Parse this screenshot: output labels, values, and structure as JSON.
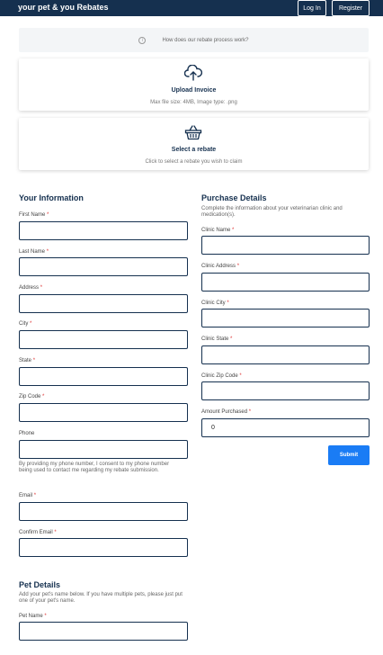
{
  "header": {
    "brand": "your pet & you Rebates",
    "login_label": "Log In",
    "register_label": "Register"
  },
  "info_bar": {
    "icon": "info-icon",
    "text": "How does our rebate process work?"
  },
  "upload_card": {
    "icon": "cloud-upload-icon",
    "title": "Upload Invoice",
    "subtitle": "Max file size: 4MB, Image type: .png"
  },
  "rebate_card": {
    "icon": "basket-icon",
    "title": "Select a rebate",
    "subtitle": "Click to select a rebate you wish to claim"
  },
  "your_info": {
    "title": "Your Information",
    "fields": [
      {
        "label": "First Name",
        "required": "*",
        "value": ""
      },
      {
        "label": "Last Name",
        "required": "*",
        "value": ""
      },
      {
        "label": "Address",
        "required": "*",
        "value": ""
      },
      {
        "label": "City",
        "required": "*",
        "value": ""
      },
      {
        "label": "State",
        "required": "*",
        "value": ""
      },
      {
        "label": "Zip Code",
        "required": "*",
        "value": ""
      },
      {
        "label": "Phone",
        "required": "",
        "value": ""
      },
      {
        "label": "Email",
        "required": "*",
        "value": ""
      },
      {
        "label": "Confirm Email",
        "required": "*",
        "value": ""
      }
    ],
    "phone_consent": "By providing my phone number, I consent to my phone number being used to contact me regarding my rebate submission."
  },
  "purchase": {
    "title": "Purchase Details",
    "description": "Complete the information about your veterinarian clinic and medication(s).",
    "fields": [
      {
        "label": "Clinic Name",
        "required": "*",
        "value": ""
      },
      {
        "label": "Clinic Address",
        "required": "*",
        "value": ""
      },
      {
        "label": "Clinic City",
        "required": "*",
        "value": ""
      },
      {
        "label": "Clinic State",
        "required": "*",
        "value": ""
      },
      {
        "label": "Clinic Zip Code",
        "required": "*",
        "value": ""
      },
      {
        "label": "Amount Purchased",
        "required": "*",
        "value": "0"
      }
    ],
    "submit_label": "Submit"
  },
  "pet_details": {
    "title": "Pet Details",
    "description": "Add your pet's name below. If you have multiple pets, please just put one of your pet's name.",
    "fields": [
      {
        "label": "Pet Name",
        "required": "*",
        "value": ""
      }
    ]
  },
  "colors": {
    "header_bg": "#15304f",
    "accent": "#1a7cf5",
    "required": "#dd3333"
  }
}
